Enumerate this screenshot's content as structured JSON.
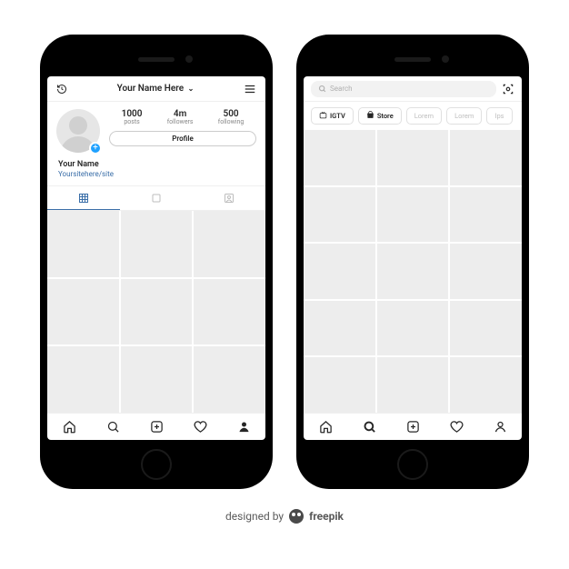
{
  "profile": {
    "header_title": "Your Name Here",
    "stats": {
      "posts": {
        "value": "1000",
        "label": "posts"
      },
      "followers": {
        "value": "4m",
        "label": "followers"
      },
      "following": {
        "value": "500",
        "label": "following"
      }
    },
    "profile_button": "Profile",
    "display_name": "Your Name",
    "website": "Yoursitehere/site"
  },
  "search": {
    "placeholder": "Search",
    "chips": {
      "igtv": "IGTV",
      "store": "Store",
      "c1": "Lorem",
      "c2": "Lorem",
      "c3": "Ips"
    }
  },
  "attribution": {
    "prefix": "designed by",
    "brand": "freepik"
  }
}
